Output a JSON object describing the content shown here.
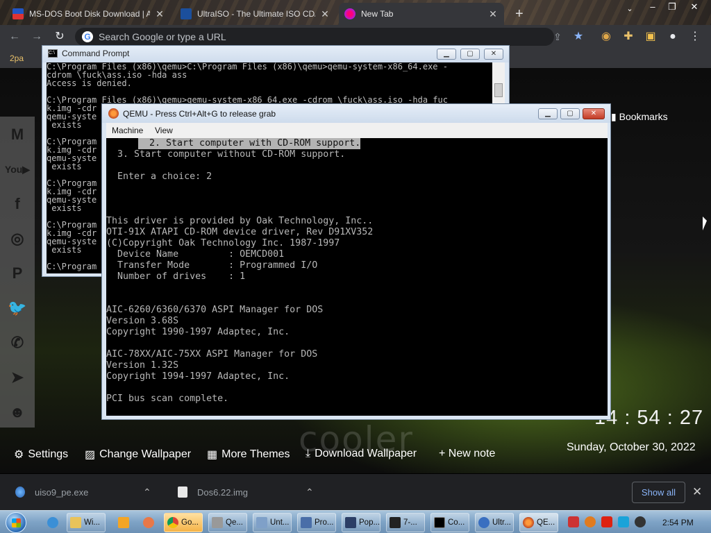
{
  "browser": {
    "tabs": [
      {
        "label": "MS-DOS Boot Disk Download | A",
        "active": false
      },
      {
        "label": "UltraISO - The Ultimate ISO CD/",
        "active": false
      },
      {
        "label": "New Tab",
        "active": true
      }
    ],
    "new_tab_glyph": "+",
    "omnibox_placeholder": "Search Google or type a URL",
    "bookmark_left": "2pa",
    "bookmarks_label": "Bookmarks"
  },
  "cmd": {
    "title": "Command Prompt",
    "lines": [
      "C:\\Program Files (x86)\\qemu>C:\\Program Files (x86)\\qemu>qemu-system-x86_64.exe -",
      "cdrom \\fuck\\ass.iso -hda ass",
      "Access is denied.",
      "",
      "C:\\Program Files (x86)\\qemu>qemu-system-x86_64.exe -cdrom \\fuck\\ass.iso -hda fuc",
      "k.img -cdr",
      "qemu-syste",
      " exists",
      "",
      "C:\\Program",
      "k.img -cdr",
      "qemu-syste",
      " exists",
      "",
      "C:\\Program",
      "k.img -cdr",
      "qemu-syste",
      " exists",
      "",
      "C:\\Program",
      "k.img -cdr",
      "qemu-syste",
      " exists",
      "",
      "C:\\Program"
    ]
  },
  "qemu": {
    "title": "QEMU - Press Ctrl+Alt+G to release grab",
    "menus": [
      "Machine",
      "View"
    ],
    "highlight_line": "  2. Start computer with CD-ROM support.",
    "lines": [
      "  3. Start computer without CD-ROM support.",
      "",
      "  Enter a choice: 2",
      "",
      "",
      "",
      "This driver is provided by Oak Technology, Inc..",
      "OTI-91X ATAPI CD-ROM device driver, Rev D91XV352",
      "(C)Copyright Oak Technology Inc. 1987-1997",
      "  Device Name         : OEMCD001",
      "  Transfer Mode       : Programmed I/O",
      "  Number of drives    : 1",
      "",
      "",
      "AIC-6260/6360/6370 ASPI Manager for DOS",
      "Version 3.68S",
      "Copyright 1990-1997 Adaptec, Inc.",
      "",
      "AIC-78XX/AIC-75XX ASPI Manager for DOS",
      "Version 1.32S",
      "Copyright 1994-1997 Adaptec, Inc.",
      "",
      "PCI bus scan complete.",
      "",
      "_"
    ]
  },
  "wallpaper": {
    "logo": "cooler",
    "clock": "14 : 54 : 27",
    "date": "Sunday, October 30, 2022",
    "links": {
      "settings": "Settings",
      "change_wallpaper": "Change Wallpaper",
      "more_themes": "More Themes",
      "download_wallpaper": "Download Wallpaper",
      "new_note": "+ New note"
    }
  },
  "downloads": {
    "items": [
      {
        "name": "uiso9_pe.exe"
      },
      {
        "name": "Dos6.22.img"
      }
    ],
    "show_all": "Show all"
  },
  "taskbar": {
    "items": [
      "Wi...",
      "Go...",
      "Qe...",
      "Unt...",
      "Pro...",
      "Pop...",
      "7-...",
      "Co...",
      "Ultr...",
      "QE..."
    ],
    "time": "2:54 PM"
  },
  "colors": {
    "wallpaper_accent": "#7fae2c",
    "dos_text": "#b8b8b8",
    "highlight_bg": "#b3b3b3"
  }
}
